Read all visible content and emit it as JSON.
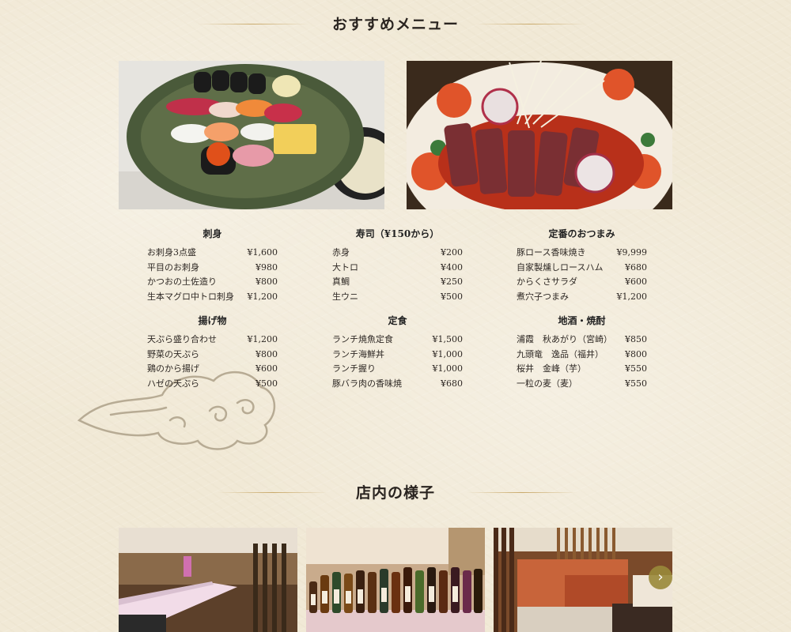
{
  "recommend": {
    "title": "おすすめメニュー",
    "sections": [
      {
        "title": "刺身",
        "items": [
          {
            "name": "お刺身3点盛",
            "price": "¥1,600"
          },
          {
            "name": "平目のお刺身",
            "price": "¥980"
          },
          {
            "name": "かつおの土佐造り",
            "price": "¥800"
          },
          {
            "name": "生本マグロ中トロ刺身",
            "price": "¥1,200"
          }
        ]
      },
      {
        "title": "寿司（¥150から）",
        "items": [
          {
            "name": "赤身",
            "price": "¥200"
          },
          {
            "name": "大トロ",
            "price": "¥400"
          },
          {
            "name": "真鯛",
            "price": "¥250"
          },
          {
            "name": "生ウニ",
            "price": "¥500"
          }
        ]
      },
      {
        "title": "定番のおつまみ",
        "items": [
          {
            "name": "豚ロース香味焼き",
            "price": "¥9,999"
          },
          {
            "name": "自家製燻しロースハム",
            "price": "¥680"
          },
          {
            "name": "からくさサラダ",
            "price": "¥600"
          },
          {
            "name": "煮穴子つまみ",
            "price": "¥1,200"
          }
        ]
      },
      {
        "title": "揚げ物",
        "items": [
          {
            "name": "天ぷら盛り合わせ",
            "price": "¥1,200"
          },
          {
            "name": "野菜の天ぷら",
            "price": "¥800"
          },
          {
            "name": "鶏のから揚げ",
            "price": "¥600"
          },
          {
            "name": "ハゼの天ぷら",
            "price": "¥500"
          }
        ]
      },
      {
        "title": "定食",
        "items": [
          {
            "name": "ランチ焼魚定食",
            "price": "¥1,500"
          },
          {
            "name": "ランチ海鮮丼",
            "price": "¥1,000"
          },
          {
            "name": "ランチ握り",
            "price": "¥1,000"
          },
          {
            "name": "豚バラ肉の香味焼",
            "price": "¥680"
          }
        ]
      },
      {
        "title": "地酒・焼酎",
        "items": [
          {
            "name": "浦霞　秋あがり（宮崎）",
            "price": "¥850"
          },
          {
            "name": "九頭竜　逸品（福井）",
            "price": "¥800"
          },
          {
            "name": "桜井　金峰（芋）",
            "price": "¥550"
          },
          {
            "name": "一粒の麦（麦）",
            "price": "¥550"
          }
        ]
      }
    ]
  },
  "interior": {
    "title": "店内の様子"
  },
  "icons": {
    "cloud": "cloud-ornament-icon",
    "next": "chevron-right-icon"
  },
  "colors": {
    "background": "#f1e9d6",
    "accent": "#9a8a3a"
  }
}
